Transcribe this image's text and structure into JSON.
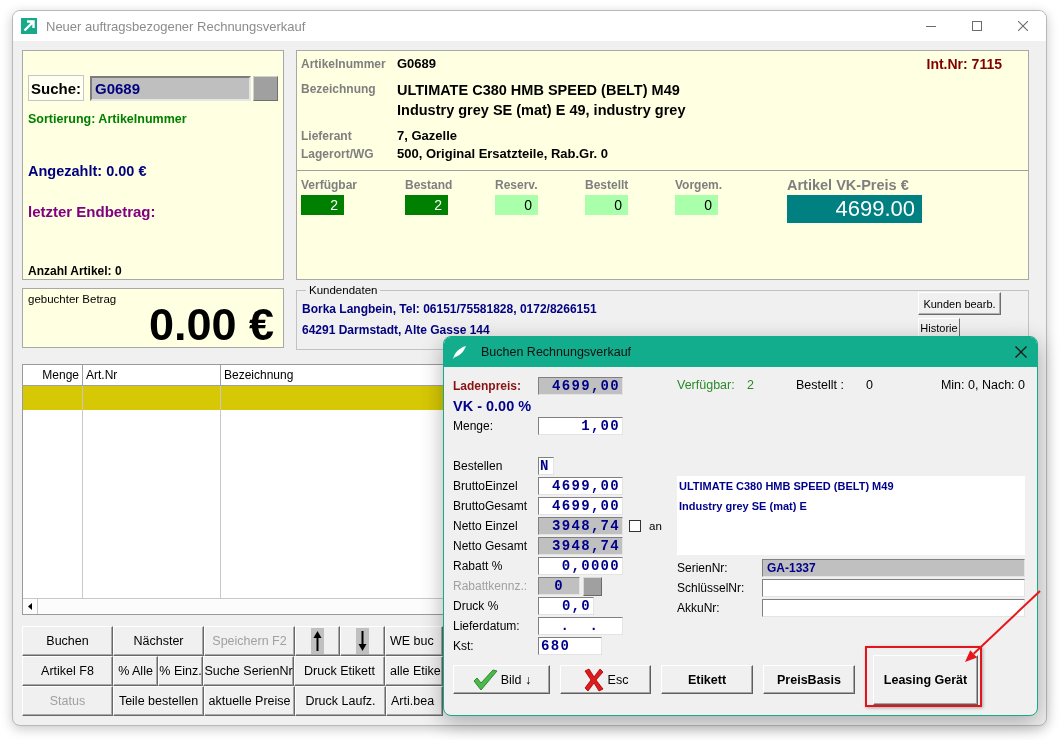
{
  "window": {
    "title": "Neuer auftragsbezogener Rechnungsverkauf"
  },
  "search_panel": {
    "search_button": "Suche:",
    "search_value": "G0689",
    "sorting": "Sortierung: Artikelnummer",
    "paid": "Angezahlt: 0.00 €",
    "last_total": "letzter Endbetrag:",
    "item_count": "Anzahl Artikel: 0"
  },
  "booked_amount": {
    "label": "gebuchter Betrag",
    "value": "0.00 €"
  },
  "article": {
    "fields": [
      {
        "label": "Artikelnummer",
        "lines": [
          "G0689"
        ]
      },
      {
        "label": "Bezeichnung",
        "lines": [
          "ULTIMATE C380 HMB SPEED (BELT) M49",
          "Industry grey SE (mat) E 49, industry grey"
        ]
      },
      {
        "label": "Lieferant",
        "lines": [
          "7, Gazelle"
        ]
      },
      {
        "label": "Lagerort/WG",
        "lines": [
          "500, Original Ersatzteile, Rab.Gr. 0"
        ]
      }
    ],
    "internal_number": "Int.Nr: 7115",
    "stock": [
      {
        "label": "Verfügbar",
        "value": "2",
        "color": "#008000"
      },
      {
        "label": "Bestand",
        "value": "2",
        "color": "#008000"
      },
      {
        "label": "Reserv.",
        "value": "0",
        "color": "#aaffaa"
      },
      {
        "label": "Bestellt",
        "value": "0",
        "color": "#aaffaa"
      },
      {
        "label": "Vorgem.",
        "value": "0",
        "color": "#aaffaa"
      }
    ],
    "price": {
      "label": "Artikel VK-Preis €",
      "value": "4699.00"
    }
  },
  "customer": {
    "title": "Kundendaten",
    "lines": [
      "Borka Langbein, Tel: 06151/75581828, 0172/8266151",
      "64291 Darmstadt, Alte Gasse 144"
    ],
    "buttons": [
      "Kunden bearb.",
      "Historie"
    ]
  },
  "table": {
    "columns": [
      "Menge",
      "Art.Nr",
      "Bezeichnung"
    ],
    "rows": [
      {
        "selected": true
      }
    ]
  },
  "command_buttons": [
    {
      "buttons": [
        {
          "label": "Buchen",
          "kind": "wide",
          "disabled": false
        },
        {
          "label": "Nächster",
          "kind": "wide",
          "disabled": false
        },
        {
          "label": "Speichern F2",
          "kind": "wide",
          "disabled": true
        },
        {
          "kind": "arrow-up",
          "disabled": false
        },
        {
          "kind": "arrow-down",
          "disabled": false
        },
        {
          "label": "WE buc",
          "kind": "cut",
          "disabled": false
        }
      ]
    },
    {
      "buttons": [
        {
          "label": "Artikel F8",
          "kind": "wide",
          "disabled": false
        },
        {
          "label": "% Alle",
          "kind": "narrow",
          "disabled": false
        },
        {
          "label": "% Einz.",
          "kind": "narrow",
          "disabled": false
        },
        {
          "label": "Suche SerienNr",
          "kind": "wide",
          "disabled": false
        },
        {
          "label": "Druck Etikett",
          "kind": "wide",
          "disabled": false
        },
        {
          "label": "alle Etike",
          "kind": "cut",
          "disabled": false
        }
      ]
    },
    {
      "buttons": [
        {
          "label": "Status",
          "kind": "wide",
          "disabled": true
        },
        {
          "label": "Teile bestellen",
          "kind": "wide",
          "disabled": false
        },
        {
          "label": "aktuelle Preise",
          "kind": "wide",
          "disabled": false
        },
        {
          "label": "Druck Laufz.",
          "kind": "wide",
          "disabled": false
        },
        {
          "label": "Arti.bea",
          "kind": "cut",
          "disabled": false
        }
      ]
    }
  ],
  "dialog": {
    "title": "Buchen Rechnungsverkauf",
    "shop_price": {
      "label": "Ladenpreis:",
      "value": "4699,00",
      "readonly": true
    },
    "price_note": "VK - 0.00 %",
    "quantity": {
      "label": "Menge:",
      "value": "1,00",
      "readonly": false
    },
    "availability": [
      {
        "label": "Verfügbar:",
        "value": "2",
        "color": "#2a8a2a"
      },
      {
        "label": "Bestellt :",
        "value": "0",
        "color": "#000000"
      }
    ],
    "minimum": "Min: 0, Nach: 0",
    "fields": [
      {
        "label": "Bestellen",
        "value": "N",
        "kind": "flag",
        "readonly": false,
        "disabled": false
      },
      {
        "label": "BruttoEinzel",
        "value": "4699,00",
        "kind": "amount",
        "readonly": false,
        "disabled": false
      },
      {
        "label": "BruttoGesamt",
        "value": "4699,00",
        "kind": "amount",
        "readonly": false,
        "disabled": false
      },
      {
        "label": "Netto Einzel",
        "value": "3948,74",
        "kind": "amount",
        "readonly": true,
        "disabled": false,
        "option": {
          "label": "an",
          "checked": false
        }
      },
      {
        "label": "Netto Gesamt",
        "value": "3948,74",
        "kind": "amount",
        "readonly": true,
        "disabled": false
      },
      {
        "label": "Rabatt %",
        "value": "0,0000",
        "kind": "amount",
        "readonly": false,
        "disabled": false
      },
      {
        "label": "Rabattkennz.:",
        "value": "0",
        "kind": "lookup",
        "readonly": true,
        "disabled": true
      },
      {
        "label": "Druck %",
        "value": "0,0",
        "kind": "short",
        "readonly": false,
        "disabled": false
      },
      {
        "label": "Lieferdatum:",
        "value": "  .  .",
        "kind": "date",
        "readonly": false,
        "disabled": false
      },
      {
        "label": "Kst:",
        "value": "680",
        "kind": "code",
        "readonly": false,
        "disabled": false
      }
    ],
    "description": [
      "ULTIMATE C380 HMB SPEED (BELT) M49",
      "Industry grey SE (mat) E"
    ],
    "article_fields": [
      {
        "label": "SerienNr:",
        "value": "GA-1337",
        "readonly": true
      },
      {
        "label": "SchlüsselNr:",
        "readonly": false
      },
      {
        "label": "AkkuNr:",
        "readonly": false
      }
    ],
    "buttons": [
      {
        "label": "Bild ↓",
        "kind": "confirm",
        "highlighted": false
      },
      {
        "label": "Esc",
        "kind": "cancel",
        "highlighted": false
      },
      {
        "label": "Etikett",
        "kind": "text",
        "highlighted": false
      },
      {
        "label": "PreisBasis",
        "kind": "text",
        "highlighted": false
      },
      {
        "label": "Leasing Gerät",
        "kind": "large",
        "highlighted": true
      }
    ]
  }
}
